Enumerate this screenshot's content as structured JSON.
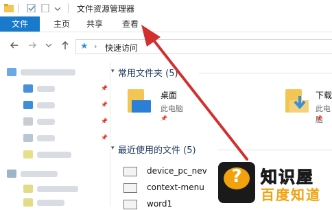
{
  "window": {
    "title": "文件资源管理器"
  },
  "ribbon": {
    "tabs": [
      "文件",
      "主页",
      "共享",
      "查看"
    ]
  },
  "address": {
    "location": "快速访问"
  },
  "quick_access": {
    "header": "常用文件夹 (5)",
    "tiles": [
      {
        "name": "桌面",
        "sub": "此电脑"
      },
      {
        "name": "下载",
        "sub": "此电脑"
      }
    ]
  },
  "recent": {
    "header": "最近使用的文件 (5)",
    "files": [
      "device_pc_nev",
      "context-menu",
      "word1"
    ]
  },
  "watermark": {
    "title": "知识屋",
    "subtitle": "百度知道",
    "badge": "?"
  },
  "colors": {
    "accent": "#1979ca",
    "arrow": "#d32f2f",
    "folder": "#f3c654"
  },
  "icons": {
    "back": "arrow-left-icon",
    "forward": "arrow-right-icon",
    "recent_menu": "chevron-down-icon",
    "up": "arrow-up-icon",
    "quick_access": "star-icon",
    "pin": "pin-icon"
  }
}
